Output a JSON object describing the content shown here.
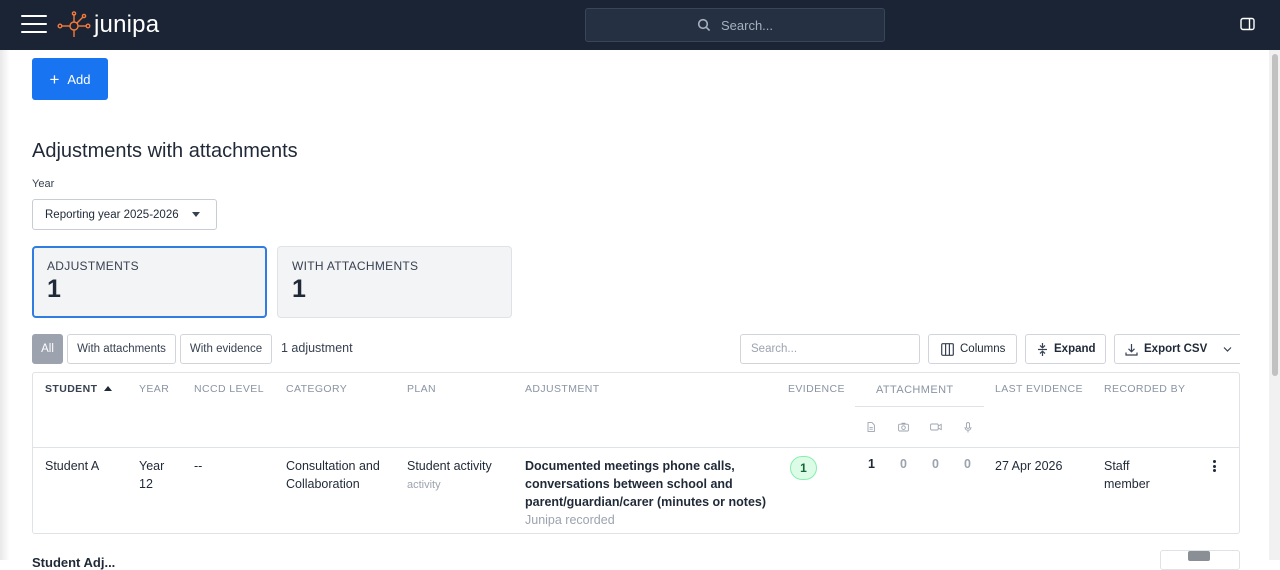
{
  "app": {
    "name": "junipa"
  },
  "topbar": {
    "search_placeholder": "Search..."
  },
  "toolbar": {
    "add_label": "Add"
  },
  "page": {
    "title": "Adjustments with attachments",
    "year_label": "Year",
    "year_value": "Reporting year 2025-2026",
    "next_section_title": "Student Adj..."
  },
  "cards": [
    {
      "label": "ADJUSTMENTS",
      "value": "1"
    },
    {
      "label": "WITH ATTACHMENTS",
      "value": "1"
    }
  ],
  "filters": [
    {
      "label": "All",
      "selected": true
    },
    {
      "label": "With attachments",
      "selected": false
    },
    {
      "label": "With evidence",
      "selected": false
    }
  ],
  "result_count": "1 adjustment",
  "table_tools": {
    "search_placeholder": "Search...",
    "columns_label": "Columns",
    "expand_label": "Expand",
    "export_label": "Export CSV"
  },
  "table": {
    "headers": {
      "student": "STUDENT",
      "year": "YEAR",
      "nccd": "NCCD LEVEL",
      "category": "CATEGORY",
      "plan": "PLAN",
      "adjustment": "ADJUSTMENT",
      "evidence": "EVIDENCE",
      "attachment": "ATTACHMENT",
      "last_evidence": "LAST EVIDENCE",
      "recorded_by": "RECORDED BY"
    },
    "attachment_icons": [
      "document-icon",
      "camera-icon",
      "video-icon",
      "microphone-icon"
    ],
    "rows": [
      {
        "student": "Student A",
        "year": "Year 12",
        "nccd": "--",
        "category": "Consultation and Collaboration",
        "plan": "Student activity",
        "plan_tag": "activity",
        "adjustment": "Documented meetings phone calls, conversations between school and parent/guardian/carer (minutes or notes)",
        "adjustment_source": "Junipa recorded",
        "evidence": "1",
        "att_documents": "1",
        "att_photos": "0",
        "att_videos": "0",
        "att_audio": "0",
        "last_evidence": "27 Apr 2026",
        "recorded_by": "Staff member"
      }
    ]
  },
  "colors": {
    "topbar": "#1b2434",
    "primary": "#1874f0",
    "accent_border": "#2f7de1",
    "evidence_badge": "#dcfce7"
  }
}
